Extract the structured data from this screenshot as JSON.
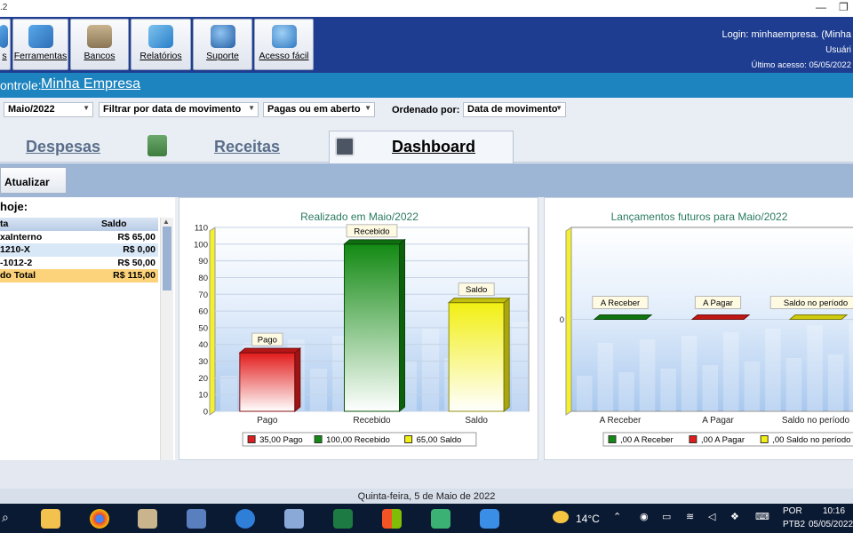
{
  "window": {
    "title": ".2",
    "minimize": "—",
    "restore": "❐"
  },
  "toolbar": {
    "buttons": [
      {
        "label": "s",
        "icon": "partial-icon"
      },
      {
        "label": "Ferramentas",
        "icon": "tools-icon"
      },
      {
        "label": "Bancos",
        "icon": "bank-icon"
      },
      {
        "label": "Relatórios",
        "icon": "reports-icon"
      },
      {
        "label": "Suporte",
        "icon": "support-icon"
      },
      {
        "label": "Acesso fácil",
        "icon": "quick-access-icon"
      }
    ],
    "login": "Login: minhaempresa. (Minha",
    "user": "Usuári",
    "last_access": "Último acesso: 05/05/2022"
  },
  "company": {
    "label": "ontrole:",
    "name": "Minha Empresa"
  },
  "filters": {
    "month": "Maio/2022",
    "filter_by": "Filtrar por data de movimento",
    "status": "Pagas ou em aberto",
    "order_label": "Ordenado por:",
    "order_by": "Data de movimento"
  },
  "tabs": {
    "despesas": "Despesas",
    "receitas": "Receitas",
    "dashboard": "Dashboard"
  },
  "actions": {
    "refresh": "Atualizar"
  },
  "accounts": {
    "title": "hoje:",
    "header": {
      "name": "ta",
      "balance": "Saldo"
    },
    "rows": [
      {
        "name": "xaInterno",
        "balance": "R$ 65,00"
      },
      {
        "name": "1210-X",
        "balance": "R$ 0,00"
      },
      {
        "name": "-1012-2",
        "balance": "R$ 50,00"
      }
    ],
    "total": {
      "name": "do Total",
      "balance": "R$ 115,00"
    }
  },
  "chart_data": [
    {
      "type": "bar",
      "title": "Realizado em Maio/2022",
      "categories": [
        "Pago",
        "Recebido",
        "Saldo"
      ],
      "values": [
        35,
        100,
        65
      ],
      "colors": [
        "#e21b1b",
        "#138a13",
        "#f2ef12"
      ],
      "data_labels": [
        "Pago",
        "Recebido",
        "Saldo"
      ],
      "ylim": [
        0,
        110
      ],
      "yticks": [
        "0",
        "10",
        "20",
        "30",
        "40",
        "50",
        "60",
        "70",
        "80",
        "90",
        "100",
        "110"
      ],
      "legend": [
        "35,00 Pago",
        "100,00 Recebido",
        "65,00 Saldo"
      ],
      "legend_position": "bottom",
      "grid": true
    },
    {
      "type": "bar",
      "title": "Lançamentos futuros para Maio/2022",
      "categories": [
        "A Receber",
        "A Pagar",
        "Saldo no período"
      ],
      "values": [
        0,
        0,
        0
      ],
      "colors": [
        "#138a13",
        "#e21b1b",
        "#f2ef12"
      ],
      "data_labels": [
        "A Receber",
        "A Pagar",
        "Saldo no período"
      ],
      "yticks": [
        "0"
      ],
      "legend": [
        ",00 A Receber",
        ",00 A Pagar",
        ",00 Saldo no período"
      ],
      "legend_position": "bottom",
      "grid": true
    }
  ],
  "status": {
    "date": "Quinta-feira, 5 de Maio de 2022"
  },
  "taskbar": {
    "weather": "14°C",
    "lang1": "POR",
    "lang2": "PTB2",
    "time": "10:16",
    "date": "05/05/2022"
  }
}
